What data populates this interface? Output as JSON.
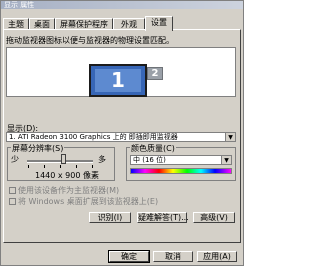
{
  "window": {
    "title": "显示 属性"
  },
  "tabs": [
    {
      "label": "主题"
    },
    {
      "label": "桌面"
    },
    {
      "label": "屏幕保护程序"
    },
    {
      "label": "外观"
    },
    {
      "label": "设置"
    }
  ],
  "settings": {
    "description": "拖动监视器图标以便与监视器的物理设置匹配。",
    "monitors": [
      {
        "number": "1"
      },
      {
        "number": "2"
      }
    ],
    "display_label": "显示(D):",
    "display_value": "1. ATI Radeon 3100 Graphics 上的 即插即用监视器",
    "resolution": {
      "title": "屏幕分辨率(S)",
      "less": "少",
      "more": "多",
      "value_text": "1440 x 900 像素",
      "slider_level_percent": 55
    },
    "color": {
      "title": "颜色质量(C)",
      "value": "中 (16 位)"
    },
    "checkbox_primary": "使用该设备作为主监视器(M)",
    "checkbox_extend": "将 Windows 桌面扩展到该监视器上(E)",
    "identify_button": "识别(I)",
    "troubleshoot_button": "疑难解答(T)...",
    "advanced_button": "高级(V)"
  },
  "footer": {
    "ok": "确定",
    "cancel": "取消",
    "apply": "应用(A)"
  }
}
